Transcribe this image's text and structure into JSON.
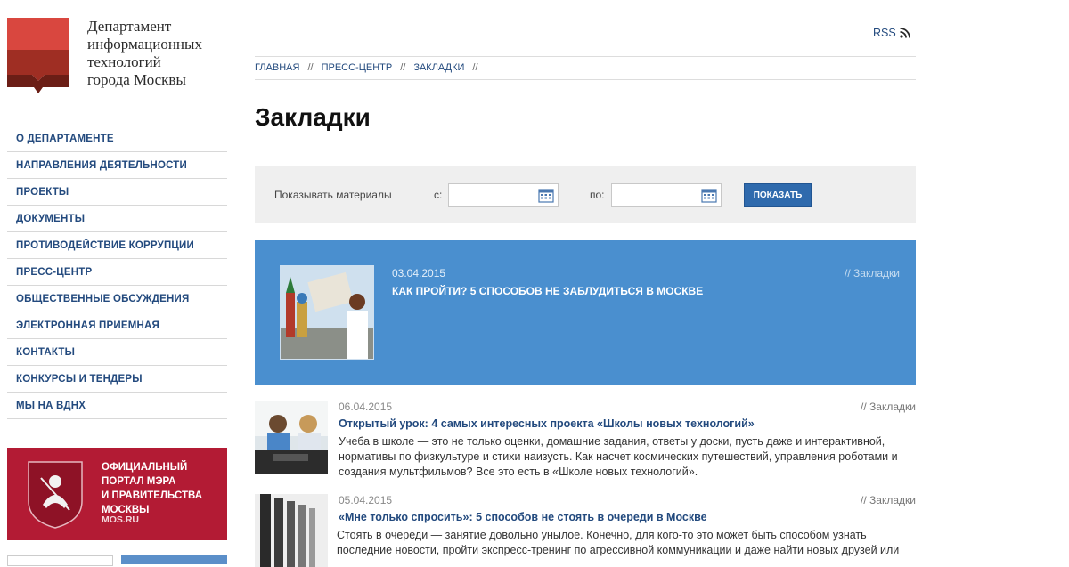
{
  "header": {
    "logo_text": "Департамент\nинформационных\nтехнологий\nгорода Москвы",
    "rss_label": "RSS"
  },
  "sidebar": {
    "items": [
      {
        "label": "О ДЕПАРТАМЕНТЕ"
      },
      {
        "label": "НАПРАВЛЕНИЯ ДЕЯТЕЛЬНОСТИ"
      },
      {
        "label": "ПРОЕКТЫ"
      },
      {
        "label": "ДОКУМЕНТЫ"
      },
      {
        "label": "ПРОТИВОДЕЙСТВИЕ КОРРУПЦИИ"
      },
      {
        "label": "ПРЕСС-ЦЕНТР"
      },
      {
        "label": "ОБЩЕСТВЕННЫЕ ОБСУЖДЕНИЯ"
      },
      {
        "label": "ЭЛЕКТРОННАЯ ПРИЕМНАЯ"
      },
      {
        "label": "КОНТАКТЫ"
      },
      {
        "label": "КОНКУРСЫ И ТЕНДЕРЫ"
      },
      {
        "label": "МЫ НА ВДНХ"
      }
    ],
    "banner": {
      "title": "ОФИЦИАЛЬНЫЙ\nПОРТАЛ МЭРА\nИ ПРАВИТЕЛЬСТВА\nМОСКВЫ",
      "site": "MOS.RU"
    }
  },
  "breadcrumb": {
    "items": [
      "ГЛАВНАЯ",
      "ПРЕСС-ЦЕНТР",
      "ЗАКЛАДКИ"
    ],
    "separator": "//"
  },
  "page": {
    "title": "Закладки"
  },
  "filter": {
    "label": "Показывать материалы",
    "from_label": "с:",
    "to_label": "по:",
    "from_value": "",
    "to_value": "",
    "button": "ПОКАЗАТЬ"
  },
  "featured": {
    "date": "03.04.2015",
    "title": "КАК ПРОЙТИ? 5 СПОСОБОВ НЕ ЗАБЛУДИТЬСЯ В МОСКВЕ",
    "tag": "// Закладки"
  },
  "news": [
    {
      "date": "06.04.2015",
      "tag": "// Закладки",
      "title": "Открытый урок: 4 самых интересных проекта «Школы новых технологий»",
      "text": "Учеба в школе — это не только оценки, домашние задания, ответы у доски, пусть даже и интерактивной, нормативы по физкультуре и стихи наизусть. Как насчет космических путешествий, управления роботами и создания мультфильмов? Все это есть в «Школе новых технологий»."
    },
    {
      "date": "05.04.2015",
      "tag": "// Закладки",
      "title": "«Мне только спросить»: 5 способов не стоять в очереди в Москве",
      "text": "Стоять в очереди — занятие довольно унылое. Конечно, для кого-то это может быть способом узнать последние новости, пройти экспресс-тренинг по агрессивной коммуникации и даже найти новых друзей или"
    }
  ],
  "colors": {
    "nav_text": "#234a7e",
    "featured_bg": "#4a8fcf",
    "banner_bg": "#b31b34",
    "button_bg": "#2f6aad"
  }
}
